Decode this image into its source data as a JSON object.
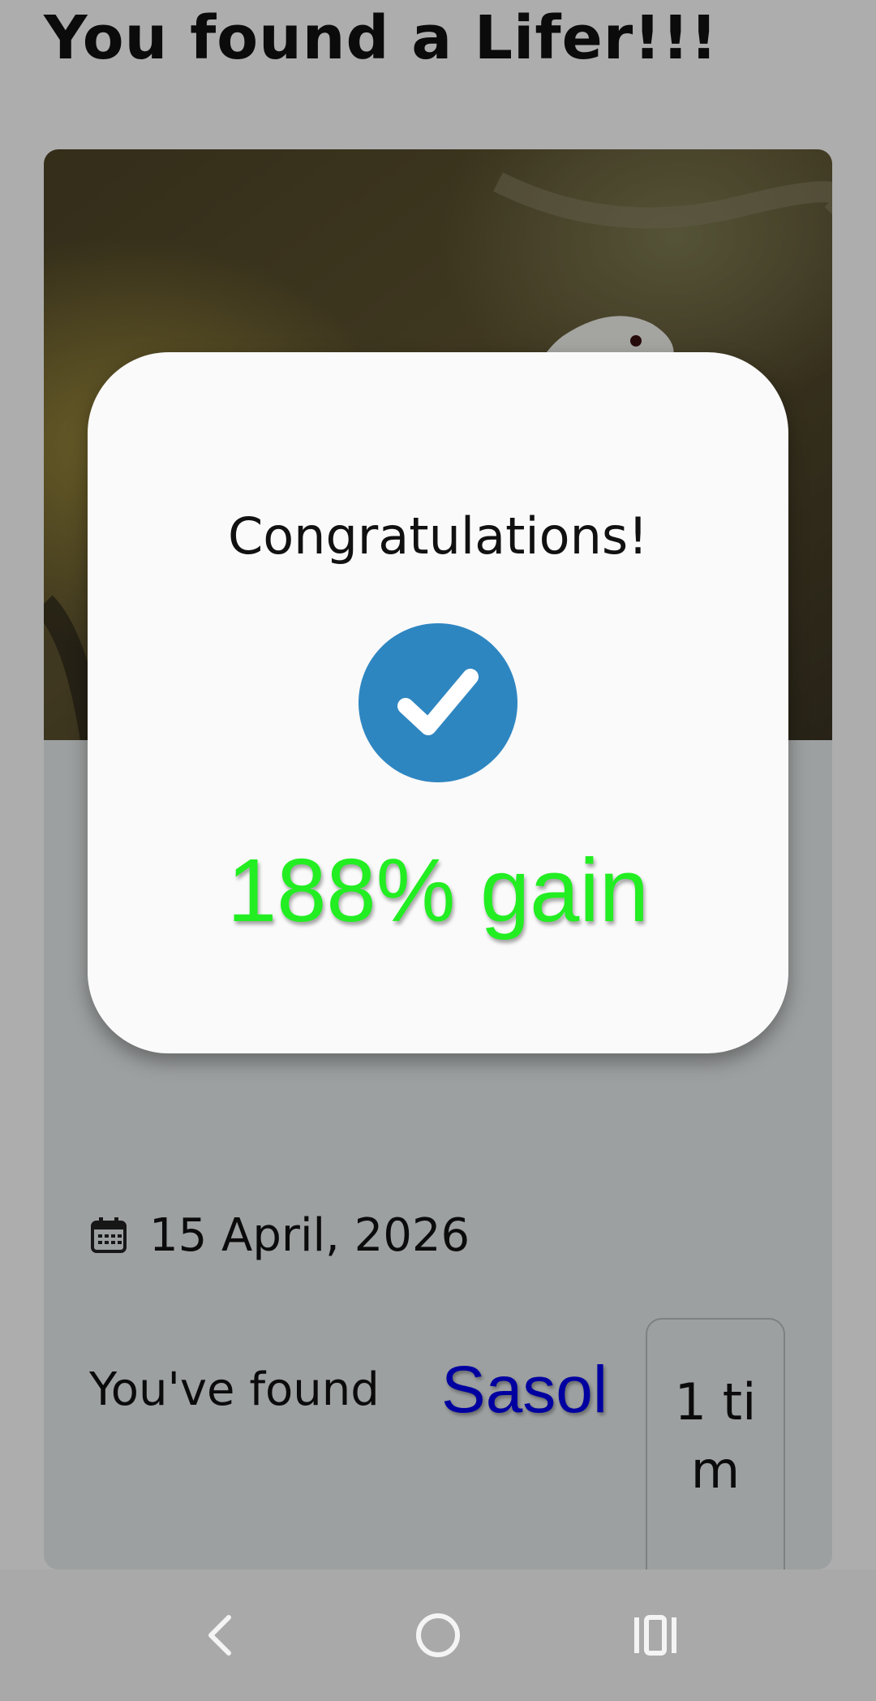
{
  "header": {
    "title": "You found a Lifer!!!"
  },
  "card": {
    "photo_subject": "gull-photo",
    "date": "15 April, 2026",
    "found_label": "You've found",
    "species": "Sasol",
    "count_text": "1 tim"
  },
  "dialog": {
    "title": "Congratulations!",
    "icon": "checkmark-icon",
    "gain_text": "188% gain"
  },
  "nav": {
    "back_icon": "back-icon",
    "home_icon": "home-icon",
    "recents_icon": "recents-icon"
  },
  "colors": {
    "gain": "#22ee22",
    "species_link": "#0000ee",
    "check_circle": "#2e86c1",
    "scrim": "rgba(0,0,0,0.32)"
  }
}
